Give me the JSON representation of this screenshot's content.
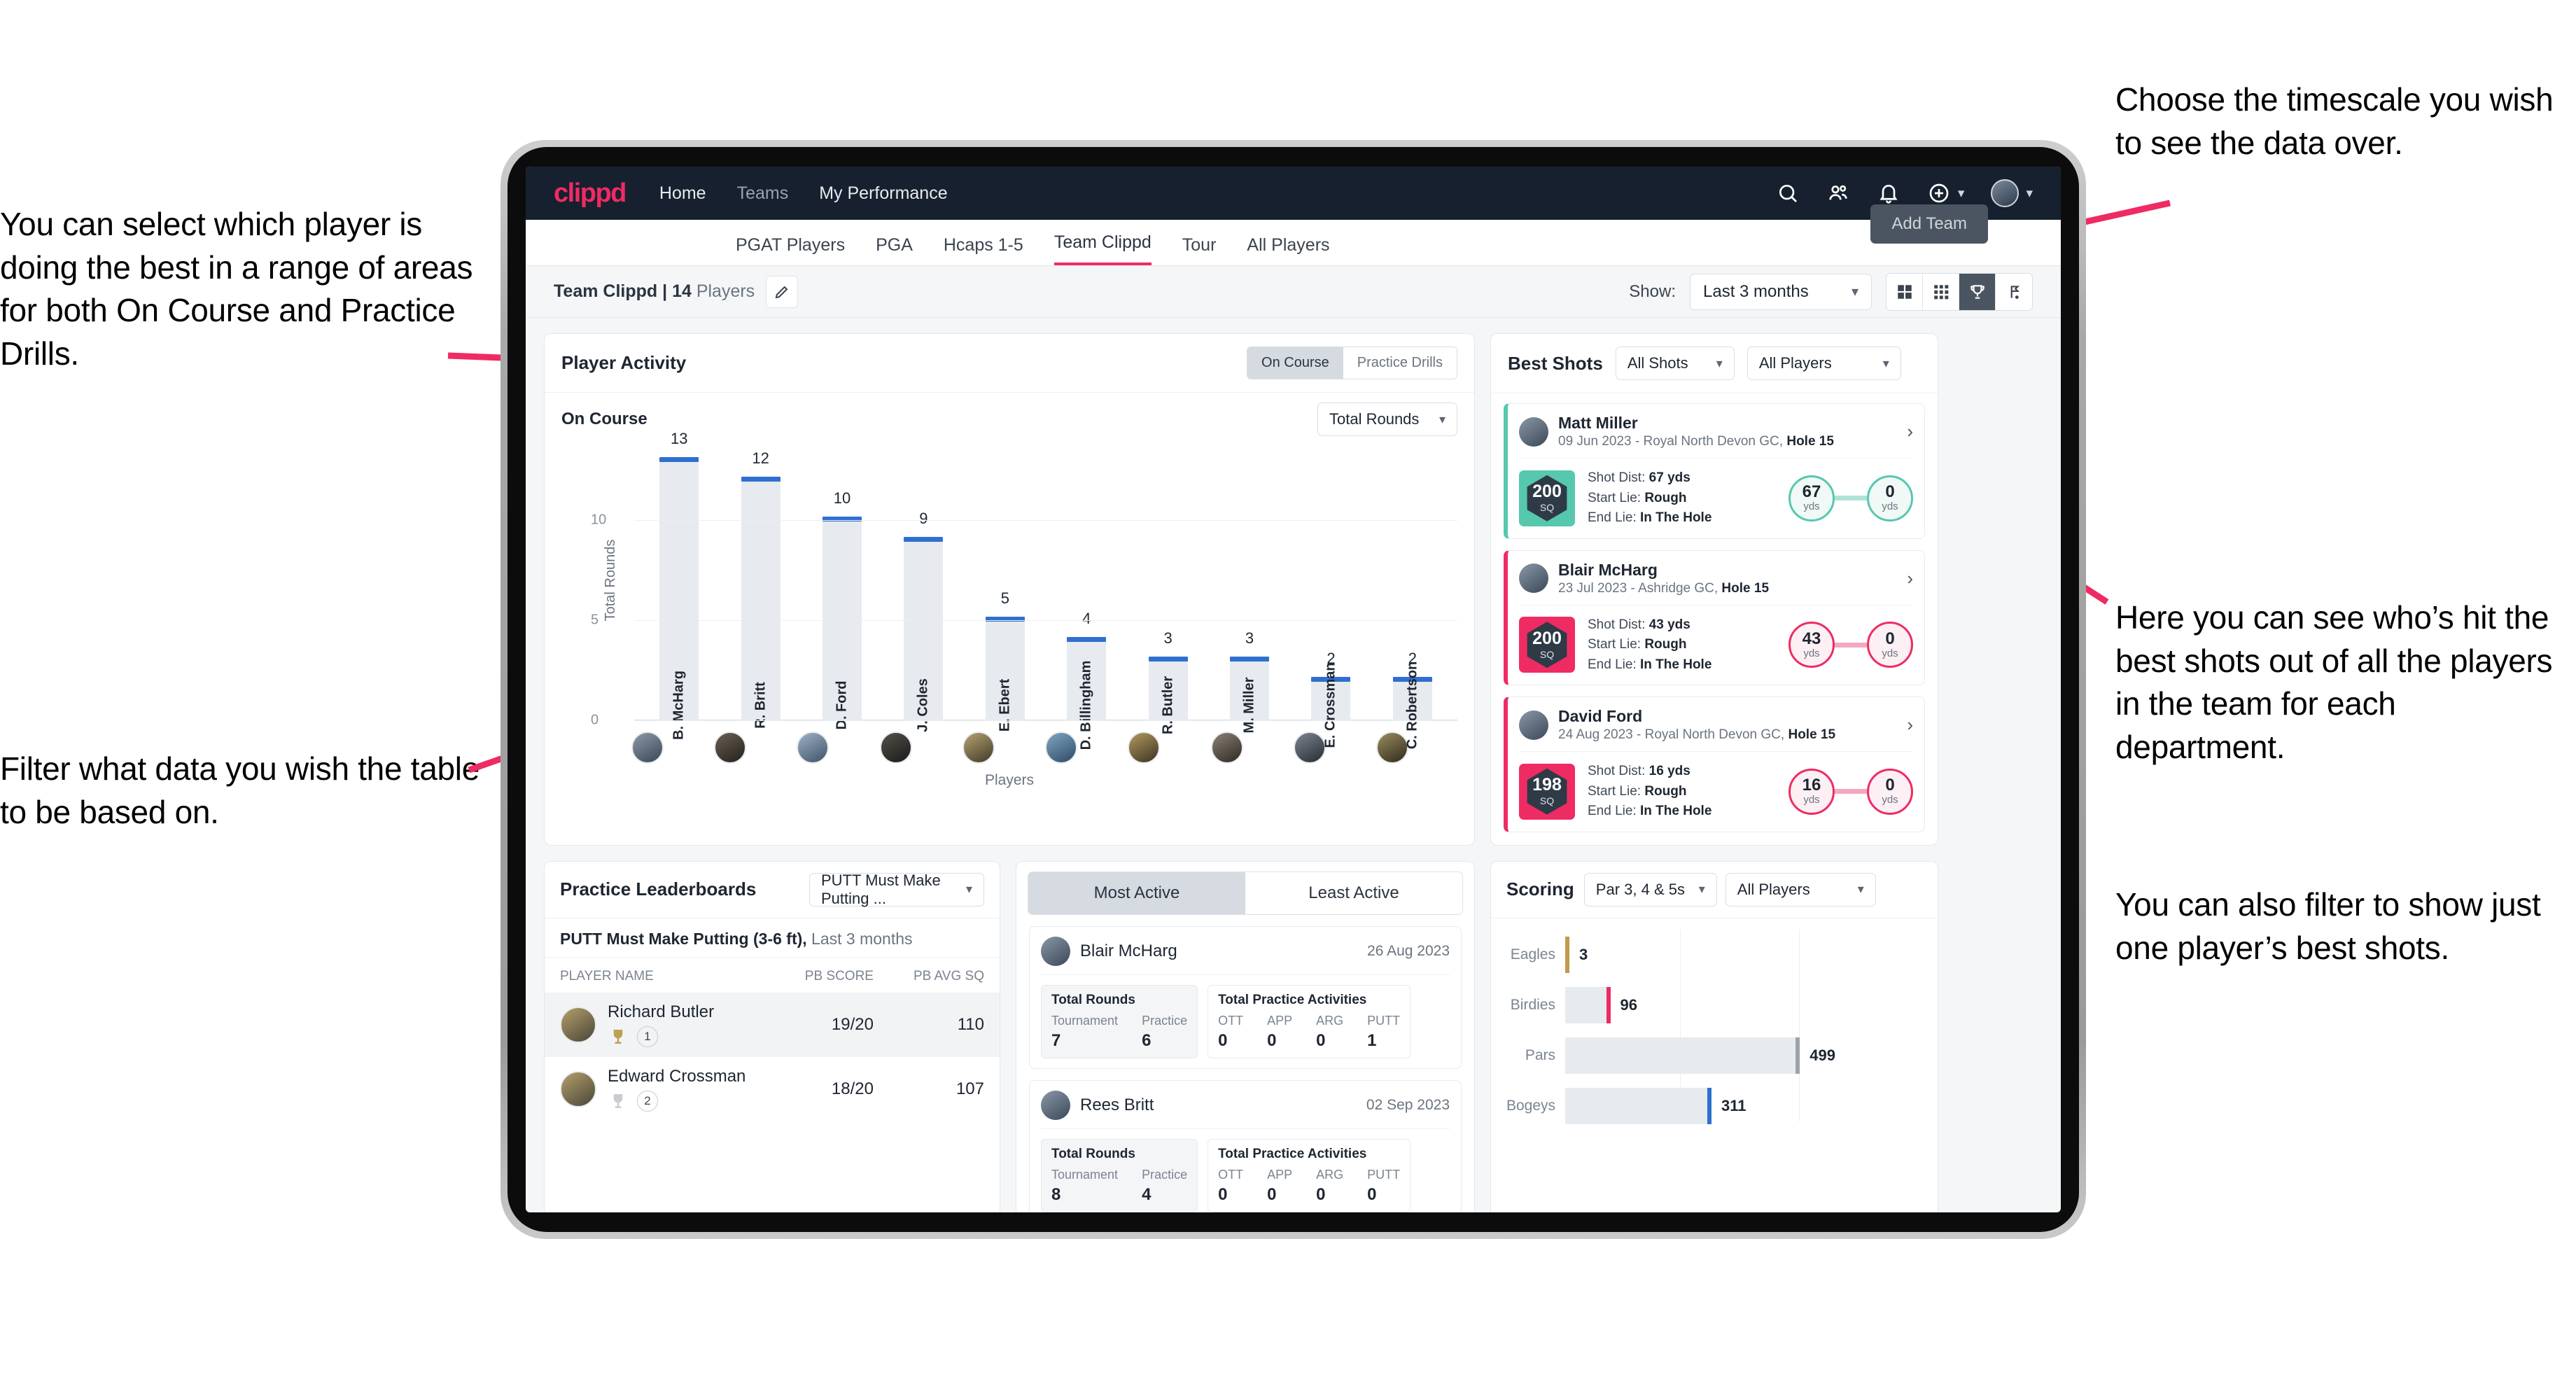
{
  "annotations": {
    "left_top": "You can select which player is doing the best in a range of areas for both On Course and Practice Drills.",
    "left_bottom": "Filter what data you wish the table to be based on.",
    "right_top": "Choose the timescale you wish to see the data over.",
    "right_mid": "Here you can see who’s hit the best shots out of all the players in the team for each department.",
    "right_bottom": "You can also filter to show just one player’s best shots."
  },
  "topnav": {
    "logo": "clippd",
    "links": [
      {
        "label": "Home",
        "active": true
      },
      {
        "label": "Teams",
        "active": false
      },
      {
        "label": "My Performance",
        "active": true
      }
    ],
    "icons": [
      "search-icon",
      "people-icon",
      "bell-icon",
      "plus-circle-icon",
      "avatar"
    ],
    "brand_color": "#ef2b63",
    "bar_color": "#16202e"
  },
  "tabs": {
    "items": [
      "PGAT Players",
      "PGA",
      "Hcaps 1-5",
      "Team Clippd",
      "Tour",
      "All Players"
    ],
    "active": "Team Clippd",
    "add_team_tooltip": "Add Team"
  },
  "subbar": {
    "team_name": "Team Clippd",
    "team_sep": " | ",
    "player_count": "14",
    "players_word": " Players",
    "edit_icon": "pencil-icon",
    "show_label": "Show:",
    "timescale_value": "Last 3 months",
    "view_modes": [
      "grid-large-icon",
      "grid-small-icon",
      "trophy-icon",
      "flag-icon"
    ],
    "view_active": "trophy-icon"
  },
  "player_activity": {
    "title": "Player Activity",
    "toggle": [
      "On Course",
      "Practice Drills"
    ],
    "toggle_active": "On Course",
    "section_label": "On Course",
    "metric_value": "Total Rounds"
  },
  "chart_data": [
    {
      "type": "bar",
      "title": "Player Activity - On Course",
      "categories": [
        "B. McHarg",
        "R. Britt",
        "D. Ford",
        "J. Coles",
        "E. Ebert",
        "D. Billingham",
        "R. Butler",
        "M. Miller",
        "E. Crossman",
        "C. Robertson"
      ],
      "values": [
        13,
        12,
        10,
        9,
        5,
        4,
        3,
        3,
        2,
        2
      ],
      "xlabel": "Players",
      "ylabel": "Total Rounds",
      "yticks": [
        0,
        5,
        10
      ],
      "ylim": [
        0,
        14
      ],
      "grid": true,
      "bar_color": "#e7eaee",
      "cap_color": "#2f6fd0"
    },
    {
      "type": "bar",
      "orientation": "horizontal",
      "title": "Scoring",
      "categories": [
        "Eagles",
        "Birdies",
        "Pars",
        "Bogeys"
      ],
      "values": [
        3,
        96,
        499,
        311
      ],
      "cap_colors": [
        "#c19a4b",
        "#ef2b63",
        "#9aa3ad",
        "#2f6fd0"
      ],
      "xlabel": "",
      "ylabel": "",
      "grid": true
    }
  ],
  "best_shots": {
    "title": "Best Shots",
    "filter_shots": "All Shots",
    "filter_players": "All Players",
    "cards": [
      {
        "name": "Matt Miller",
        "meta_date": "09 Jun 2023 - Royal North Devon GC, ",
        "meta_hole": "Hole 15",
        "sq": "200",
        "sq_unit": "SQ",
        "accent": "#56c8ae",
        "shot_dist_label": "Shot Dist: ",
        "shot_dist": "67 yds",
        "start_lie_label": "Start Lie: ",
        "start_lie": "Rough",
        "end_lie_label": "End Lie: ",
        "end_lie": "In The Hole",
        "from_value": "67",
        "from_unit": "yds",
        "to_value": "0",
        "to_unit": "yds"
      },
      {
        "name": "Blair McHarg",
        "meta_date": "23 Jul 2023 - Ashridge GC, ",
        "meta_hole": "Hole 15",
        "sq": "200",
        "sq_unit": "SQ",
        "accent": "#ef2b63",
        "shot_dist_label": "Shot Dist: ",
        "shot_dist": "43 yds",
        "start_lie_label": "Start Lie: ",
        "start_lie": "Rough",
        "end_lie_label": "End Lie: ",
        "end_lie": "In The Hole",
        "from_value": "43",
        "from_unit": "yds",
        "to_value": "0",
        "to_unit": "yds"
      },
      {
        "name": "David Ford",
        "meta_date": "24 Aug 2023 - Royal North Devon GC, ",
        "meta_hole": "Hole 15",
        "sq": "198",
        "sq_unit": "SQ",
        "accent": "#ef2b63",
        "shot_dist_label": "Shot Dist: ",
        "shot_dist": "16 yds",
        "start_lie_label": "Start Lie: ",
        "start_lie": "Rough",
        "end_lie_label": "End Lie: ",
        "end_lie": "In The Hole",
        "from_value": "16",
        "from_unit": "yds",
        "to_value": "0",
        "to_unit": "yds"
      }
    ]
  },
  "practice_leaderboards": {
    "title": "Practice Leaderboards",
    "drill_select": "PUTT Must Make Putting ...",
    "subtitle_bold": "PUTT Must Make Putting (3-6 ft),",
    "subtitle_light": " Last 3 months",
    "columns": [
      "PLAYER NAME",
      "PB SCORE",
      "PB AVG SQ"
    ],
    "rows": [
      {
        "name": "Richard Butler",
        "rank": "1",
        "pb_score": "19/20",
        "pb_avg_sq": "110",
        "trophy": "gold"
      },
      {
        "name": "Edward Crossman",
        "rank": "2",
        "pb_score": "18/20",
        "pb_avg_sq": "107",
        "trophy": "silver"
      }
    ]
  },
  "activity": {
    "tabs": [
      "Most Active",
      "Least Active"
    ],
    "tab_active": "Most Active",
    "rounds_title": "Total Rounds",
    "practice_title": "Total Practice Activities",
    "rounds_keys": [
      "Tournament",
      "Practice"
    ],
    "practice_keys": [
      "OTT",
      "APP",
      "ARG",
      "PUTT"
    ],
    "cards": [
      {
        "name": "Blair McHarg",
        "date": "26 Aug 2023",
        "rounds": [
          "7",
          "6"
        ],
        "practice": [
          "0",
          "0",
          "0",
          "1"
        ]
      },
      {
        "name": "Rees Britt",
        "date": "02 Sep 2023",
        "rounds": [
          "8",
          "4"
        ],
        "practice": [
          "0",
          "0",
          "0",
          "0"
        ]
      }
    ]
  },
  "scoring": {
    "title": "Scoring",
    "filter_par": "Par 3, 4 & 5s",
    "filter_players": "All Players"
  }
}
